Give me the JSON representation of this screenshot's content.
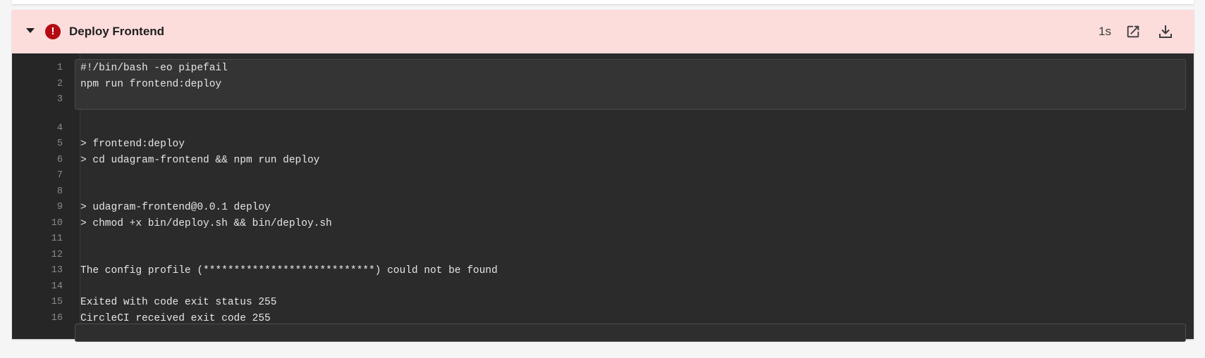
{
  "step": {
    "title": "Deploy Frontend",
    "duration": "1s",
    "status": "failed",
    "status_color": "#b40a12",
    "header_color": "#fddcdc",
    "icons": {
      "collapse": "caret-down-icon",
      "status": "error-circle-icon",
      "open": "open-in-new-icon",
      "download": "download-icon"
    }
  },
  "output": {
    "lines": [
      {
        "n": "1",
        "text": "#!/bin/bash -eo pipefail"
      },
      {
        "n": "2",
        "text": "npm run frontend:deploy"
      },
      {
        "n": "3",
        "text": ""
      },
      {
        "n": "4",
        "text": ""
      },
      {
        "n": "5",
        "text": "> frontend:deploy"
      },
      {
        "n": "6",
        "text": "> cd udagram-frontend && npm run deploy"
      },
      {
        "n": "7",
        "text": ""
      },
      {
        "n": "8",
        "text": ""
      },
      {
        "n": "9",
        "text": "> udagram-frontend@0.0.1 deploy"
      },
      {
        "n": "10",
        "text": "> chmod +x bin/deploy.sh && bin/deploy.sh"
      },
      {
        "n": "11",
        "text": ""
      },
      {
        "n": "12",
        "text": ""
      },
      {
        "n": "13",
        "text": "The config profile (****************************) could not be found"
      },
      {
        "n": "14",
        "text": ""
      },
      {
        "n": "15",
        "text": "Exited with code exit status 255"
      },
      {
        "n": "16",
        "text": "CircleCI received exit code 255"
      }
    ]
  }
}
